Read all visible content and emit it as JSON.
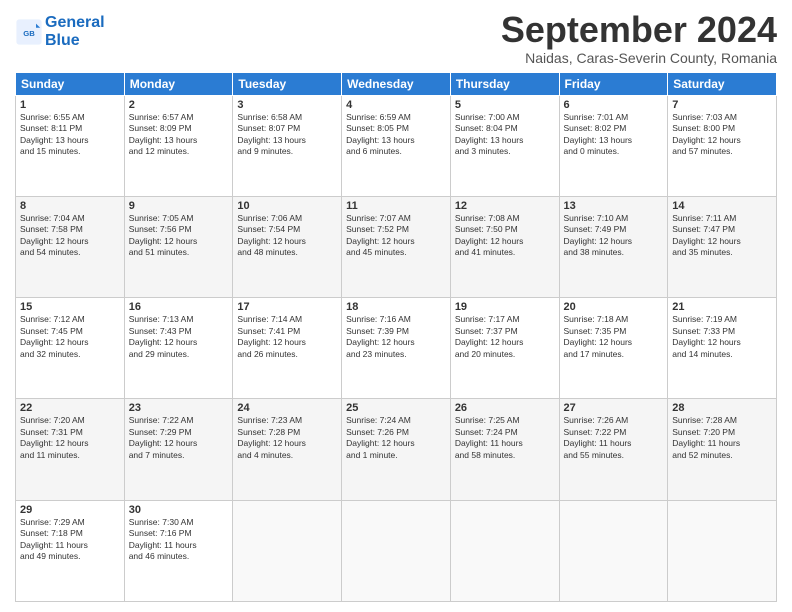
{
  "header": {
    "logo_line1": "General",
    "logo_line2": "Blue",
    "month": "September 2024",
    "location": "Naidas, Caras-Severin County, Romania"
  },
  "days_of_week": [
    "Sunday",
    "Monday",
    "Tuesday",
    "Wednesday",
    "Thursday",
    "Friday",
    "Saturday"
  ],
  "weeks": [
    [
      {
        "day": "1",
        "info": "Sunrise: 6:55 AM\nSunset: 8:11 PM\nDaylight: 13 hours\nand 15 minutes."
      },
      {
        "day": "2",
        "info": "Sunrise: 6:57 AM\nSunset: 8:09 PM\nDaylight: 13 hours\nand 12 minutes."
      },
      {
        "day": "3",
        "info": "Sunrise: 6:58 AM\nSunset: 8:07 PM\nDaylight: 13 hours\nand 9 minutes."
      },
      {
        "day": "4",
        "info": "Sunrise: 6:59 AM\nSunset: 8:05 PM\nDaylight: 13 hours\nand 6 minutes."
      },
      {
        "day": "5",
        "info": "Sunrise: 7:00 AM\nSunset: 8:04 PM\nDaylight: 13 hours\nand 3 minutes."
      },
      {
        "day": "6",
        "info": "Sunrise: 7:01 AM\nSunset: 8:02 PM\nDaylight: 13 hours\nand 0 minutes."
      },
      {
        "day": "7",
        "info": "Sunrise: 7:03 AM\nSunset: 8:00 PM\nDaylight: 12 hours\nand 57 minutes."
      }
    ],
    [
      {
        "day": "8",
        "info": "Sunrise: 7:04 AM\nSunset: 7:58 PM\nDaylight: 12 hours\nand 54 minutes."
      },
      {
        "day": "9",
        "info": "Sunrise: 7:05 AM\nSunset: 7:56 PM\nDaylight: 12 hours\nand 51 minutes."
      },
      {
        "day": "10",
        "info": "Sunrise: 7:06 AM\nSunset: 7:54 PM\nDaylight: 12 hours\nand 48 minutes."
      },
      {
        "day": "11",
        "info": "Sunrise: 7:07 AM\nSunset: 7:52 PM\nDaylight: 12 hours\nand 45 minutes."
      },
      {
        "day": "12",
        "info": "Sunrise: 7:08 AM\nSunset: 7:50 PM\nDaylight: 12 hours\nand 41 minutes."
      },
      {
        "day": "13",
        "info": "Sunrise: 7:10 AM\nSunset: 7:49 PM\nDaylight: 12 hours\nand 38 minutes."
      },
      {
        "day": "14",
        "info": "Sunrise: 7:11 AM\nSunset: 7:47 PM\nDaylight: 12 hours\nand 35 minutes."
      }
    ],
    [
      {
        "day": "15",
        "info": "Sunrise: 7:12 AM\nSunset: 7:45 PM\nDaylight: 12 hours\nand 32 minutes."
      },
      {
        "day": "16",
        "info": "Sunrise: 7:13 AM\nSunset: 7:43 PM\nDaylight: 12 hours\nand 29 minutes."
      },
      {
        "day": "17",
        "info": "Sunrise: 7:14 AM\nSunset: 7:41 PM\nDaylight: 12 hours\nand 26 minutes."
      },
      {
        "day": "18",
        "info": "Sunrise: 7:16 AM\nSunset: 7:39 PM\nDaylight: 12 hours\nand 23 minutes."
      },
      {
        "day": "19",
        "info": "Sunrise: 7:17 AM\nSunset: 7:37 PM\nDaylight: 12 hours\nand 20 minutes."
      },
      {
        "day": "20",
        "info": "Sunrise: 7:18 AM\nSunset: 7:35 PM\nDaylight: 12 hours\nand 17 minutes."
      },
      {
        "day": "21",
        "info": "Sunrise: 7:19 AM\nSunset: 7:33 PM\nDaylight: 12 hours\nand 14 minutes."
      }
    ],
    [
      {
        "day": "22",
        "info": "Sunrise: 7:20 AM\nSunset: 7:31 PM\nDaylight: 12 hours\nand 11 minutes."
      },
      {
        "day": "23",
        "info": "Sunrise: 7:22 AM\nSunset: 7:29 PM\nDaylight: 12 hours\nand 7 minutes."
      },
      {
        "day": "24",
        "info": "Sunrise: 7:23 AM\nSunset: 7:28 PM\nDaylight: 12 hours\nand 4 minutes."
      },
      {
        "day": "25",
        "info": "Sunrise: 7:24 AM\nSunset: 7:26 PM\nDaylight: 12 hours\nand 1 minute."
      },
      {
        "day": "26",
        "info": "Sunrise: 7:25 AM\nSunset: 7:24 PM\nDaylight: 11 hours\nand 58 minutes."
      },
      {
        "day": "27",
        "info": "Sunrise: 7:26 AM\nSunset: 7:22 PM\nDaylight: 11 hours\nand 55 minutes."
      },
      {
        "day": "28",
        "info": "Sunrise: 7:28 AM\nSunset: 7:20 PM\nDaylight: 11 hours\nand 52 minutes."
      }
    ],
    [
      {
        "day": "29",
        "info": "Sunrise: 7:29 AM\nSunset: 7:18 PM\nDaylight: 11 hours\nand 49 minutes."
      },
      {
        "day": "30",
        "info": "Sunrise: 7:30 AM\nSunset: 7:16 PM\nDaylight: 11 hours\nand 46 minutes."
      },
      {
        "day": "",
        "info": ""
      },
      {
        "day": "",
        "info": ""
      },
      {
        "day": "",
        "info": ""
      },
      {
        "day": "",
        "info": ""
      },
      {
        "day": "",
        "info": ""
      }
    ]
  ]
}
